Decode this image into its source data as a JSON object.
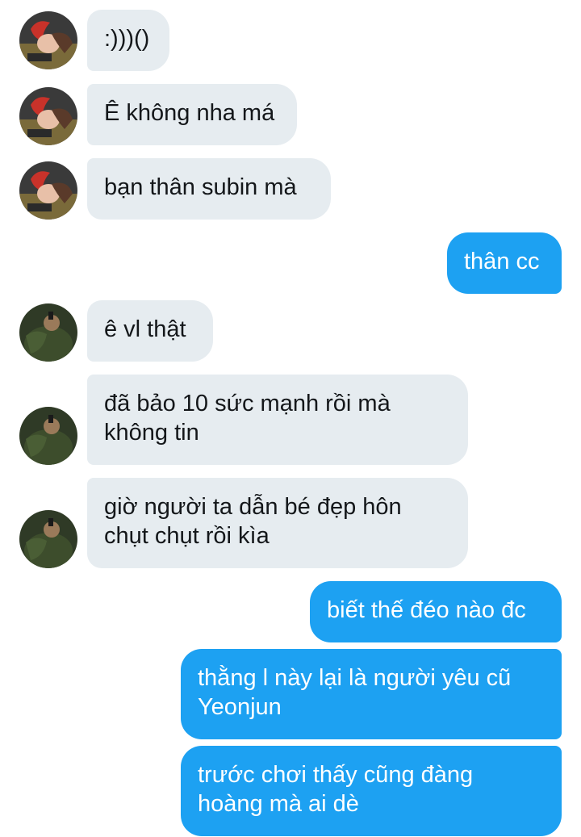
{
  "conversation": {
    "messages": [
      {
        "sender": "other",
        "avatar": "red-hair-anime-avatar",
        "text": ":)))()"
      },
      {
        "sender": "other",
        "avatar": "red-hair-anime-avatar",
        "text": "Ê không nha má"
      },
      {
        "sender": "other",
        "avatar": "red-hair-anime-avatar",
        "text": "bạn thân subin mà"
      },
      {
        "sender": "self",
        "text": "thân cc"
      },
      {
        "sender": "other2",
        "avatar": "green-hulk-avatar",
        "text": "ê vl thật"
      },
      {
        "sender": "other2",
        "avatar": "green-hulk-avatar",
        "text": "đã bảo 10 sức mạnh rồi mà không tin"
      },
      {
        "sender": "other2",
        "avatar": "green-hulk-avatar",
        "text": "giờ người ta dẫn bé đẹp hôn chụt chụt rồi kìa"
      },
      {
        "sender": "self",
        "text": "biết thế đéo nào đc"
      },
      {
        "sender": "self",
        "text": "thằng l này lại là người yêu cũ Yeonjun"
      },
      {
        "sender": "self",
        "text": "trước chơi thấy cũng đàng hoàng mà ai dè"
      }
    ]
  },
  "colors": {
    "incoming_bubble": "#e6ecf0",
    "outgoing_bubble": "#1da1f2",
    "incoming_text": "#14171a",
    "outgoing_text": "#ffffff"
  }
}
